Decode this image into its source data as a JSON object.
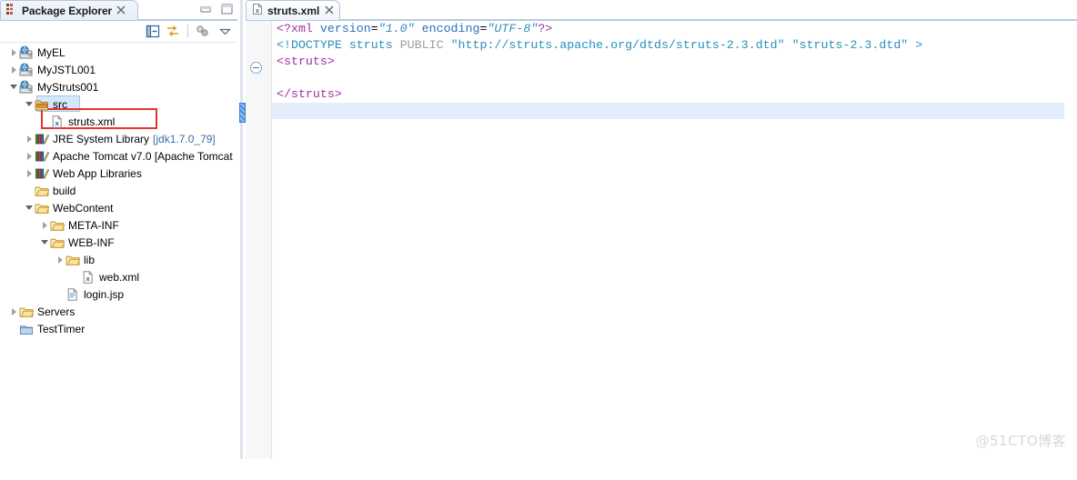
{
  "explorer": {
    "tab_label": "Package Explorer",
    "tab_close_icon": "close-icon",
    "minimize_icon": "minimize-icon",
    "maximize_icon": "maximize-icon",
    "toolbar": [
      {
        "name": "collapse-all-icon",
        "tooltip": "Collapse All"
      },
      {
        "name": "link-with-editor-icon",
        "tooltip": "Link with Editor"
      },
      {
        "name": "view-menu-icon",
        "tooltip": "View Menu"
      },
      {
        "name": "chevron-down-icon",
        "tooltip": "Menu"
      }
    ],
    "tree": [
      {
        "label": "MyEL",
        "icon": "web-project-icon",
        "indent": 0,
        "state": "closed",
        "selected": false
      },
      {
        "label": "MyJSTL001",
        "icon": "web-project-icon",
        "indent": 0,
        "state": "closed",
        "selected": false
      },
      {
        "label": "MyStruts001",
        "icon": "web-project-icon",
        "indent": 0,
        "state": "open",
        "selected": false
      },
      {
        "label": "src",
        "icon": "source-folder-icon",
        "indent": 1,
        "state": "open",
        "selected": true
      },
      {
        "label": "struts.xml",
        "icon": "xml-file-icon",
        "indent": 2,
        "state": "none",
        "selected": false,
        "highlighted": true
      },
      {
        "label": "JRE System Library",
        "suffix": "[jdk1.7.0_79]",
        "icon": "library-icon",
        "indent": 1,
        "state": "closed",
        "selected": false
      },
      {
        "label": "Apache Tomcat v7.0 [Apache Tomcat",
        "icon": "library-icon",
        "indent": 1,
        "state": "closed",
        "selected": false
      },
      {
        "label": "Web App Libraries",
        "icon": "library-icon",
        "indent": 1,
        "state": "closed",
        "selected": false
      },
      {
        "label": "build",
        "icon": "folder-icon",
        "indent": 1,
        "state": "none",
        "selected": false
      },
      {
        "label": "WebContent",
        "icon": "folder-icon",
        "indent": 1,
        "state": "open",
        "selected": false
      },
      {
        "label": "META-INF",
        "icon": "folder-icon",
        "indent": 2,
        "state": "closed",
        "selected": false
      },
      {
        "label": "WEB-INF",
        "icon": "folder-icon",
        "indent": 2,
        "state": "open",
        "selected": false
      },
      {
        "label": "lib",
        "icon": "folder-icon",
        "indent": 3,
        "state": "closed",
        "selected": false
      },
      {
        "label": "web.xml",
        "icon": "xml-file-icon",
        "indent": 4,
        "state": "none",
        "selected": false
      },
      {
        "label": "login.jsp",
        "icon": "jsp-file-icon",
        "indent": 3,
        "state": "none",
        "selected": false
      },
      {
        "label": "Servers",
        "icon": "folder-icon",
        "indent": 0,
        "state": "closed",
        "selected": false
      },
      {
        "label": "TestTimer",
        "icon": "project-icon",
        "indent": 0,
        "state": "none",
        "selected": false
      }
    ]
  },
  "editor": {
    "tab_label": "struts.xml",
    "tab_icon": "xml-file-icon",
    "tab_close_icon": "close-icon",
    "fold_marker_icon": "fold-collapse-icon",
    "code": {
      "line1": {
        "pi_open": "<?xml",
        "attr1_name": "version",
        "attr1_eq": "=",
        "attr1_value": "\"1.0\"",
        "attr2_name": "encoding",
        "attr2_eq": "=",
        "attr2_value": "\"UTF-8\"",
        "pi_close": "?>"
      },
      "line2": {
        "doctype_open": "<!DOCTYPE",
        "root": "struts",
        "kind": "PUBLIC",
        "public_id": "\"http://struts.apache.org/dtds/struts-2.3.dtd\"",
        "system_id": "\"struts-2.3.dtd\"",
        "close": ">"
      },
      "line3": "<struts>",
      "line4": "",
      "line5": "</struts>",
      "line6": ""
    }
  },
  "watermark": "@51CTO博客"
}
